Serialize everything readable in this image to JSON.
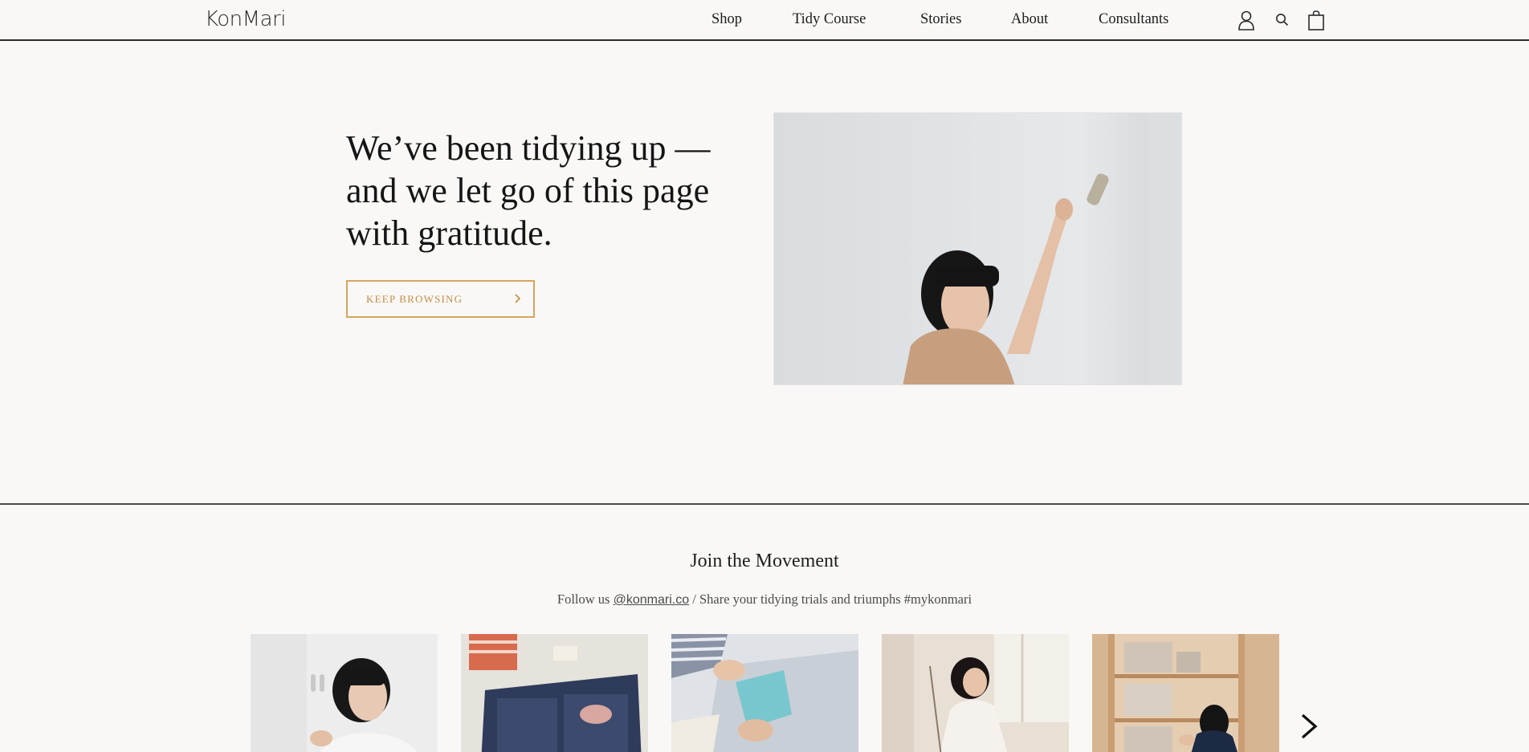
{
  "header": {
    "logo": "KonMari",
    "nav": [
      "Shop",
      "Tidy Course",
      "Stories",
      "About",
      "Consultants"
    ],
    "icons": [
      "account-icon",
      "search-icon",
      "cart-icon"
    ]
  },
  "hero": {
    "title": "We’ve been tidying up — and we let go of this page with gratitude.",
    "button_label": "KEEP BROWSING",
    "image_alt": "Woman raising a smoking sage bundle toward a white wall"
  },
  "join": {
    "title": "Join the Movement",
    "sub_prefix": "Follow us ",
    "handle": "@konmari.co",
    "sub_suffix": " / Share your tidying trials and triumphs #mykonmari",
    "photos": [
      "Woman holding a small jar",
      "Packed suitcase with folded clothes",
      "Hands folding a blue cloth",
      "Woman in white robe by a window",
      "Person arranging boxes on wooden shelves"
    ]
  },
  "colors": {
    "background": "#f9f8f6",
    "accent": "#d7a45d",
    "text": "#1c1c1c"
  }
}
